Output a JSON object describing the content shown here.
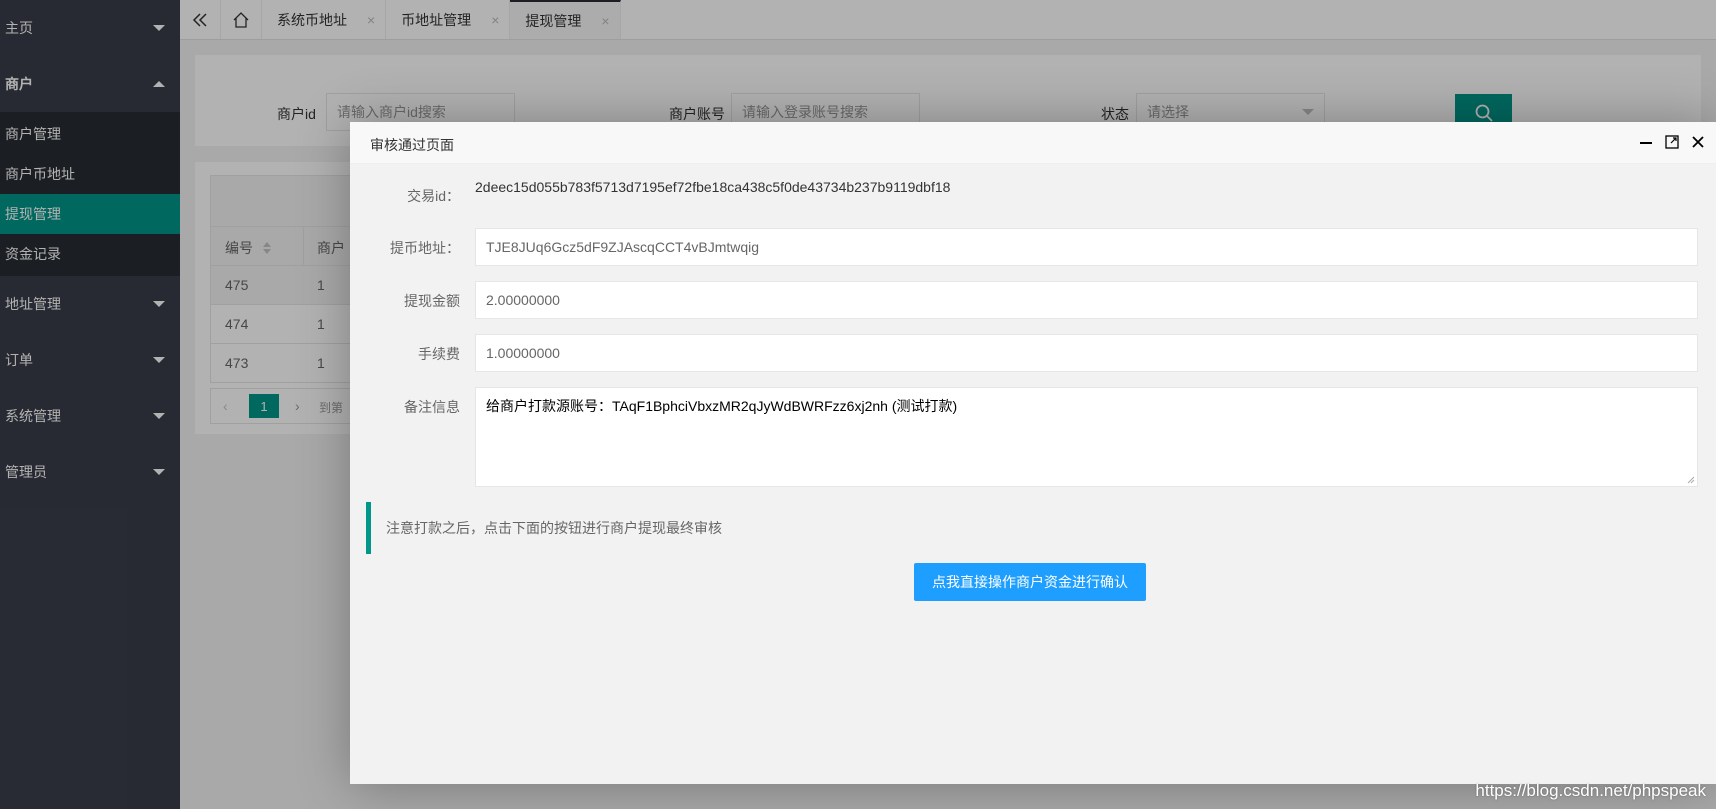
{
  "sidebar": {
    "sections": [
      {
        "label": "主页",
        "expanded": false
      },
      {
        "label": "商户",
        "expanded": true,
        "items": [
          {
            "label": "商户管理",
            "active": false
          },
          {
            "label": "商户币地址",
            "active": false
          },
          {
            "label": "提现管理",
            "active": true
          },
          {
            "label": "资金记录",
            "active": false
          }
        ]
      },
      {
        "label": "地址管理",
        "expanded": false
      },
      {
        "label": "订单",
        "expanded": false
      },
      {
        "label": "系统管理",
        "expanded": false
      },
      {
        "label": "管理员",
        "expanded": false
      }
    ]
  },
  "tabs": {
    "items": [
      {
        "label": "系统币地址"
      },
      {
        "label": "币地址管理"
      },
      {
        "label": "提现管理",
        "active": true
      }
    ],
    "close_glyph": "×"
  },
  "search": {
    "merchant_id_label": "商户id",
    "merchant_id_placeholder": "请输入商户id搜索",
    "account_label": "商户账号",
    "account_placeholder": "请输入登录账号搜索",
    "status_label": "状态",
    "status_placeholder": "请选择"
  },
  "table": {
    "headers": [
      "编号",
      "商户"
    ],
    "rows": [
      [
        "475",
        "1"
      ],
      [
        "474",
        "1"
      ],
      [
        "473",
        "1"
      ]
    ],
    "pager": {
      "current_page": "1",
      "goto_label": "到第"
    }
  },
  "modal": {
    "title": "审核通过页面",
    "tx_id_label": "交易id：",
    "tx_id_value": "2deec15d055b783f5713d7195ef72fbe18ca438c5f0de43734b237b9119dbf18",
    "address_label": "提币地址：",
    "address_value": "TJE8JUq6Gcz5dF9ZJAscqCCT4vBJmtwqig",
    "amount_label": "提现金额",
    "amount_value": "2.00000000",
    "fee_label": "手续费",
    "fee_value": "1.00000000",
    "remark_label": "备注信息",
    "remark_value": "给商户打款源账号：TAqF1BphciVbxzMR2qJyWdBWRFzz6xj2nh (测试打款)",
    "notice": "注意打款之后，点击下面的按钮进行商户提现最终审核",
    "confirm_button": "点我直接操作商户资金进行确认"
  },
  "watermark": "https://blog.csdn.net/phpspeak",
  "colors": {
    "primary": "#009688",
    "button_blue": "#1e9fff",
    "sidebar_bg": "#393d49"
  }
}
